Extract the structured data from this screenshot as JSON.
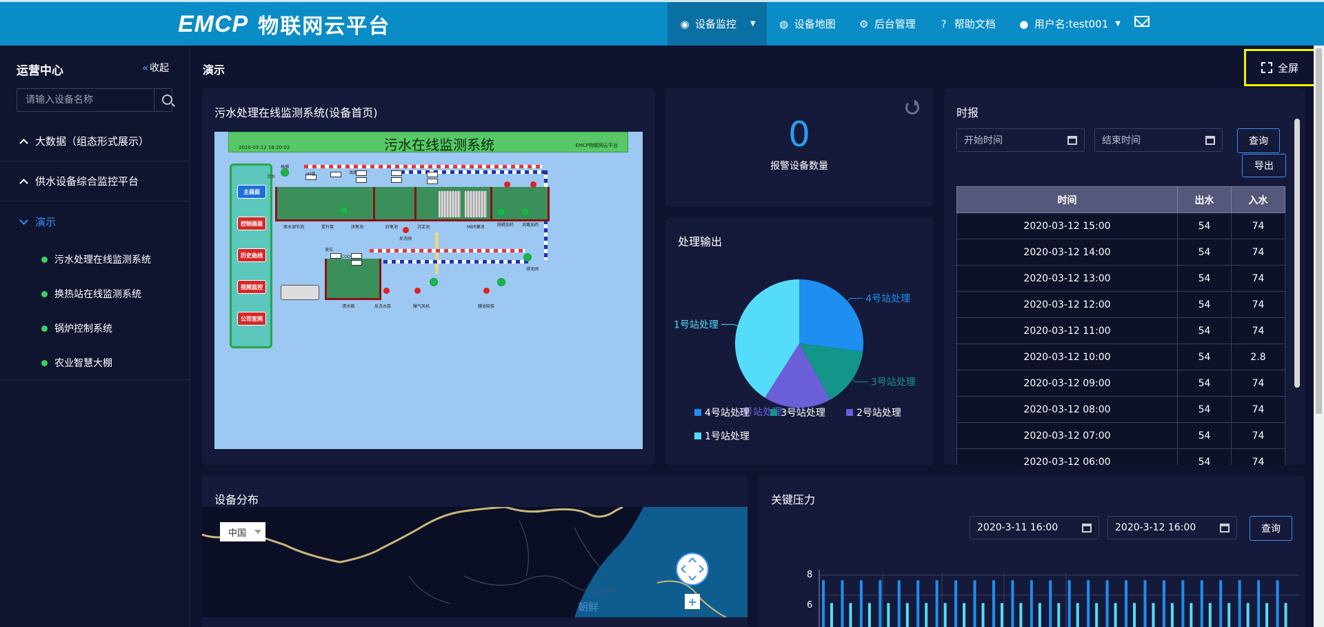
{
  "app": {
    "brand_mark": "EMCP",
    "brand_text": "物联网云平台"
  },
  "nav": {
    "items": [
      {
        "label": "设备监控",
        "icon": "monitor-icon",
        "active": true
      },
      {
        "label": "设备地图",
        "icon": "globe-icon"
      },
      {
        "label": "后台管理",
        "icon": "gears-icon"
      },
      {
        "label": "帮助文档",
        "icon": "help-icon"
      },
      {
        "label": "用户名:test001",
        "icon": "user-icon"
      }
    ]
  },
  "sidebar": {
    "title": "运营中心",
    "collapse_label": "收起",
    "search_placeholder": "请输入设备名称",
    "groups": [
      {
        "label": "大数据（组态形式展示）"
      },
      {
        "label": "供水设备综合监控平台"
      },
      {
        "label": "演示"
      }
    ],
    "sub_items": [
      {
        "label": "污水处理在线监测系统"
      },
      {
        "label": "换热站在线监测系统"
      },
      {
        "label": "锅炉控制系统"
      },
      {
        "label": "农业智慧大棚"
      }
    ]
  },
  "page": {
    "title": "演示",
    "fullscreen_label": "全屏"
  },
  "scada_card": {
    "title": "污水处理在线监测系统(设备首页)",
    "banner_title": "污水在线监测系统",
    "banner_date": "2020-03-12 16:20:02",
    "banner_brand": "EMCP物联网云平台",
    "panel_buttons": [
      "主画面",
      "控制画面",
      "历史曲线",
      "视频监控",
      "公司官网"
    ],
    "labels": [
      "污水",
      "格栅",
      "pH值",
      "原水调节池",
      "提升泵",
      "厌氧池",
      "好氧池",
      "沉淀池",
      "MBR膜池",
      "除磷加药",
      "消毒加药",
      "反洗阀",
      "清水箱",
      "反洗水泵",
      "曝气风机",
      "膜池吸泵",
      "排泥阀",
      "液位",
      "COD",
      "浊度"
    ]
  },
  "alarm_card": {
    "count": "0",
    "label": "报警设备数量"
  },
  "output_card": {
    "title": "处理输出"
  },
  "chart_data": {
    "type": "pie",
    "title": "处理输出",
    "series": [
      {
        "name": "4号站处理",
        "value": 27,
        "color": "#1e8ef0"
      },
      {
        "name": "3号站处理",
        "value": 15,
        "color": "#14958a"
      },
      {
        "name": "2号站处理",
        "value": 17,
        "color": "#6a5fd8"
      },
      {
        "name": "1号站处理",
        "value": 41,
        "color": "#56dcfb"
      }
    ],
    "legend": [
      "4号站处理",
      "3号站处理",
      "2号站处理",
      "1号站处理"
    ],
    "legend_placement": "bottom"
  },
  "report_card": {
    "title": "时报",
    "start_placeholder": "开始时间",
    "end_placeholder": "结束时间",
    "query_label": "查询",
    "export_label": "导出",
    "columns": [
      "时间",
      "出水",
      "入水"
    ],
    "rows": [
      [
        "2020-03-12 15:00",
        "54",
        "74"
      ],
      [
        "2020-03-12 14:00",
        "54",
        "74"
      ],
      [
        "2020-03-12 13:00",
        "54",
        "74"
      ],
      [
        "2020-03-12 12:00",
        "54",
        "74"
      ],
      [
        "2020-03-12 11:00",
        "54",
        "74"
      ],
      [
        "2020-03-12 10:00",
        "54",
        "2.8"
      ],
      [
        "2020-03-12 09:00",
        "54",
        "74"
      ],
      [
        "2020-03-12 08:00",
        "54",
        "74"
      ],
      [
        "2020-03-12 07:00",
        "54",
        "74"
      ],
      [
        "2020-03-12 06:00",
        "54",
        "74"
      ]
    ]
  },
  "map_card": {
    "title": "设备分布",
    "region_select": "中国",
    "map_label": "朝鲜",
    "zoom_in": "+"
  },
  "pressure_card": {
    "title": "关键压力",
    "start": "2020-3-11 16:00",
    "end": "2020-3-12 16:00",
    "query_label": "查询",
    "y_ticks": [
      "8",
      "6"
    ]
  },
  "pressure_chart": {
    "type": "bar",
    "ylim": [
      0,
      8
    ],
    "series": [
      {
        "values": [
          7.5,
          7.5,
          7.5,
          7.5,
          7.5,
          7.5,
          7.5,
          7.5,
          7.5,
          7.5,
          7.5,
          7.5,
          7.5,
          7.5,
          7.5,
          7.5,
          7.5,
          7.5,
          7.5,
          7.5,
          7.5,
          7.5,
          7.5,
          7.5,
          7.5
        ],
        "color": "#1e8ef0"
      },
      {
        "values": [
          5.2,
          5.2,
          5.2,
          5.2,
          5.2,
          5.2,
          5.2,
          5.2,
          5.2,
          5.2,
          5.2,
          5.2,
          5.2,
          5.2,
          5.2,
          5.2,
          5.2,
          5.2,
          5.2,
          5.2,
          5.2,
          5.2,
          5.2,
          5.2,
          5.2
        ],
        "color": "#56dcfb"
      }
    ]
  }
}
